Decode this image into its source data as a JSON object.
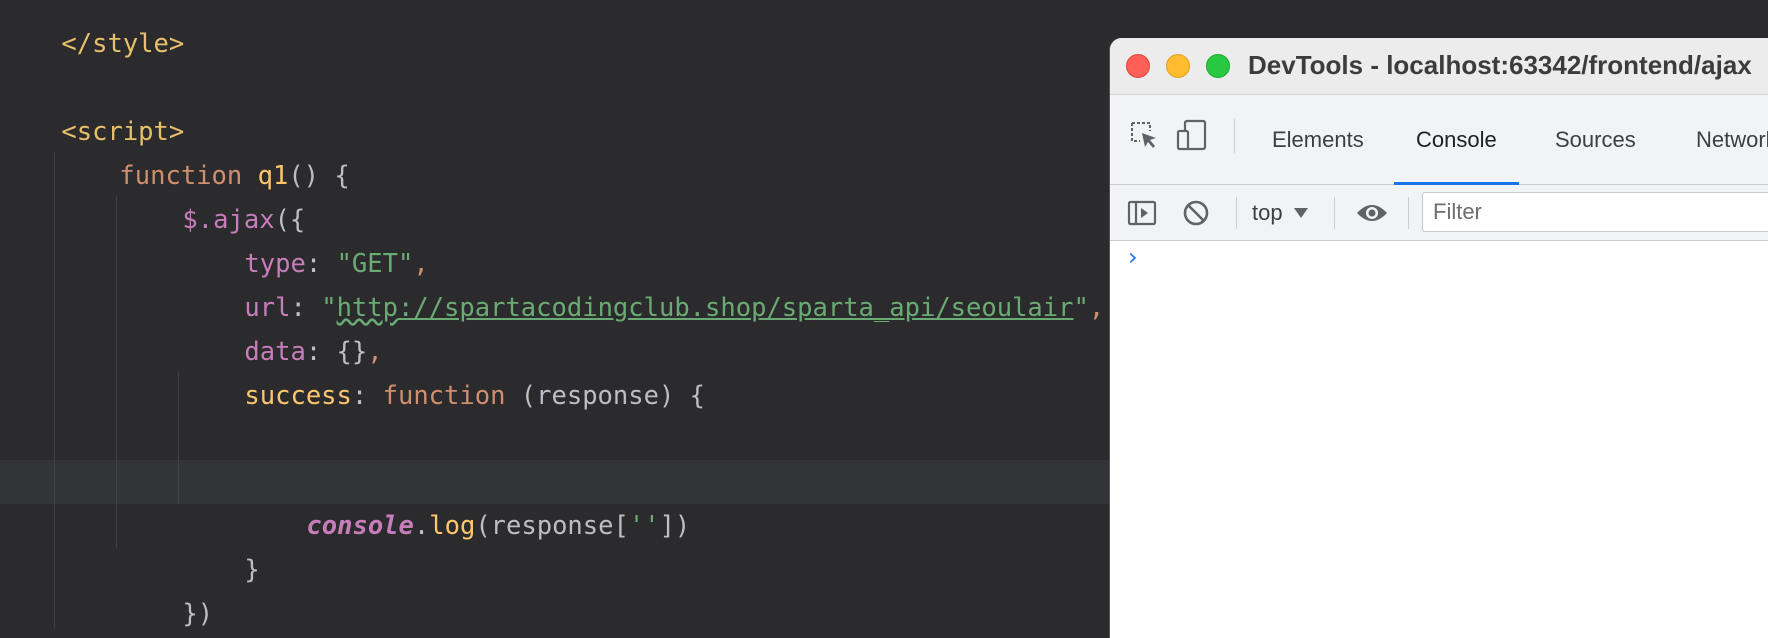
{
  "editor": {
    "lines": {
      "style_close": "</style>",
      "script_open": "<script>",
      "fn_kw": "function",
      "fn_name": "q1",
      "fn_rest": "() {",
      "ajax_prefix": "$.",
      "ajax_name": "ajax",
      "ajax_rest": "({",
      "type_key": "type",
      "type_colon": ": ",
      "type_val": "\"GET\"",
      "type_comma": ",",
      "url_key": "url",
      "url_colon": ": ",
      "url_quote_open": "\"",
      "url_http": "http",
      "url_rest": "://spartacodingclub.shop/sparta_api/seoulair",
      "url_quote_close": "\"",
      "url_comma": ",",
      "data_key": "data",
      "data_rest": ": {}",
      "data_comma": ",",
      "success_key": "success",
      "success_colon": ": ",
      "success_kw": "function",
      "success_rest": " (response) {",
      "console_obj": "console",
      "console_dot": ".",
      "console_method": "log",
      "console_args_open": "(response[",
      "console_str": "''",
      "console_args_close": "])",
      "close_brace": "}",
      "close_ajax": "})"
    }
  },
  "devtools": {
    "window_title": "DevTools - localhost:63342/frontend/ajax",
    "tabs": [
      "Elements",
      "Console",
      "Sources",
      "Network"
    ],
    "active_tab": "Console",
    "context": "top",
    "filter_placeholder": "Filter",
    "prompt": "›",
    "colors": {
      "accent": "#1a73e8",
      "close": "#fe5f57",
      "minimize": "#febc2e",
      "zoom": "#28c840"
    }
  }
}
